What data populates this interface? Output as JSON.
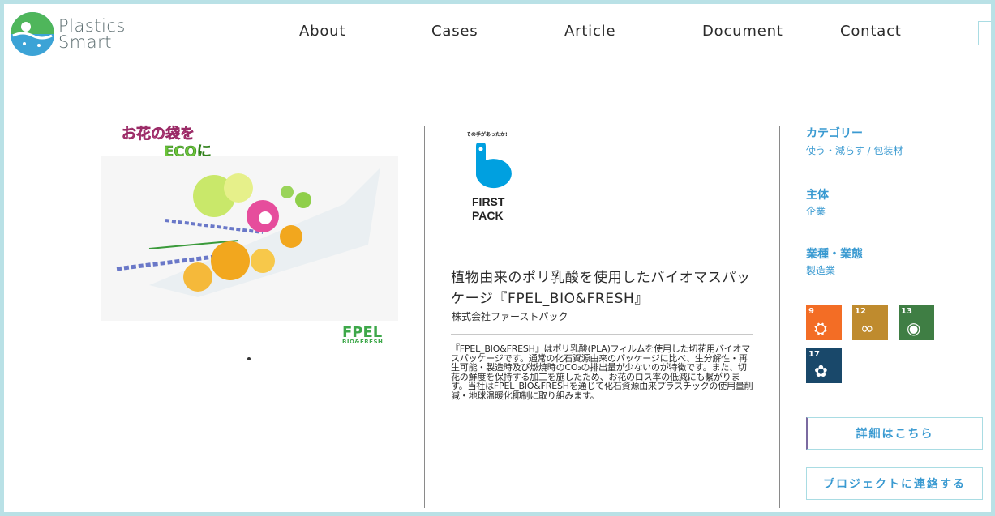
{
  "brand": {
    "line1": "Plastics",
    "line2": "Smart"
  },
  "nav": {
    "about": "About",
    "cases": "Cases",
    "article": "Article",
    "document": "Document",
    "contact": "Contact"
  },
  "gallery": {
    "headline_part1": "お花の袋を",
    "headline_part2": "ECOに",
    "product_logo": "FPEL",
    "product_logo_sub": "BIO&FRESH"
  },
  "company_logo": {
    "tagline": "その手があったか!",
    "name_line1": "FIRST",
    "name_line2": "PACK"
  },
  "project": {
    "title": "植物由来のポリ乳酸を使用したバイオマスパッケージ『FPEL_BIO&FRESH』",
    "company": "株式会社ファーストパック",
    "description": "『FPEL_BIO&FRESH』はポリ乳酸(PLA)フィルムを使用した切花用バイオマスパッケージです。通常の化石資源由来のパッケージに比べ、生分解性・再生可能・製造時及び燃焼時のCO₂の排出量が少ないのが特徴です。また、切花の鮮度を保持する加工を施したため、お花のロス率の低減にも繋がります。当社はFPEL_BIO&FRESHを通じて化石資源由来プラスチックの使用量削減・地球温暖化抑制に取り組みます。"
  },
  "sidebar": {
    "category_label": "カテゴリー",
    "category_value": "使う・減らす / 包装材",
    "entity_label": "主体",
    "entity_value": "企業",
    "industry_label": "業種・業態",
    "industry_value": "製造業",
    "sdgs": [
      {
        "num": "9",
        "color": "#f36d25",
        "icon": "industry-icon"
      },
      {
        "num": "12",
        "color": "#bf8b2e",
        "icon": "infinity-icon"
      },
      {
        "num": "13",
        "color": "#3f7e44",
        "icon": "eye-earth-icon"
      },
      {
        "num": "17",
        "color": "#19486a",
        "icon": "partnership-icon"
      }
    ],
    "details_button": "詳細はこちら",
    "contact_button": "プロジェクトに連絡する"
  }
}
